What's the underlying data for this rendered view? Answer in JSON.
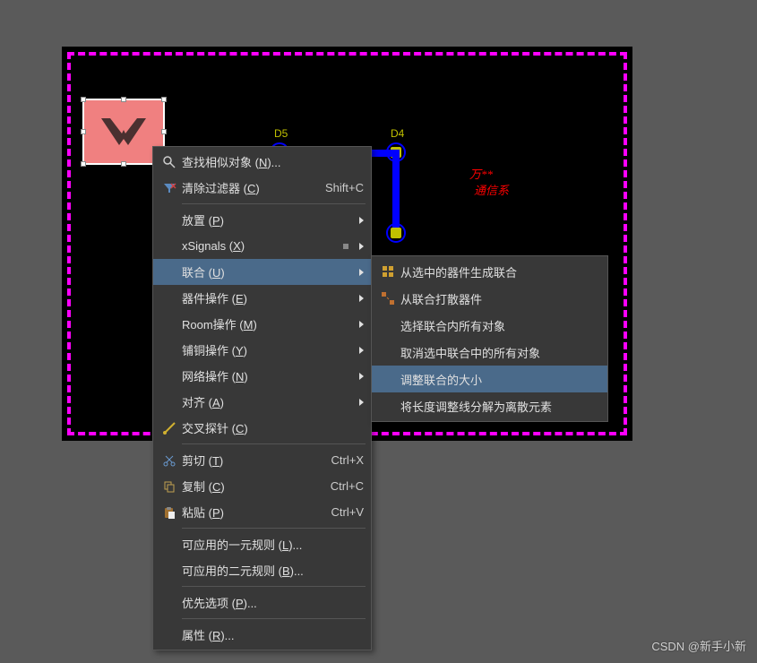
{
  "board": {
    "labels": {
      "d5": "D5",
      "d4": "D4"
    },
    "text1": "万**",
    "text2": "通信系"
  },
  "menu": {
    "items": [
      {
        "label": "查找相似对象 (N)...",
        "icon": "search-icon"
      },
      {
        "label": "清除过滤器 (C)",
        "shortcut": "Shift+C",
        "icon": "filter-clear-icon"
      },
      {
        "sep": true
      },
      {
        "label": "放置 (P)",
        "arrow": true
      },
      {
        "label": "xSignals (X)",
        "arrow": true,
        "dot": true
      },
      {
        "label": "联合 (U)",
        "arrow": true,
        "selected": true
      },
      {
        "label": "器件操作 (E)",
        "arrow": true
      },
      {
        "label": "Room操作 (M)",
        "arrow": true
      },
      {
        "label": "铺铜操作 (Y)",
        "arrow": true
      },
      {
        "label": "网络操作 (N)",
        "arrow": true
      },
      {
        "label": "对齐 (A)",
        "arrow": true
      },
      {
        "label": "交叉探针 (C)",
        "icon": "probe-icon"
      },
      {
        "sep": true
      },
      {
        "label": "剪切 (T)",
        "shortcut": "Ctrl+X",
        "icon": "cut-icon"
      },
      {
        "label": "复制 (C)",
        "shortcut": "Ctrl+C",
        "icon": "copy-icon"
      },
      {
        "label": "粘贴 (P)",
        "shortcut": "Ctrl+V",
        "icon": "paste-icon"
      },
      {
        "sep": true
      },
      {
        "label": "可应用的一元规则 (L)..."
      },
      {
        "label": "可应用的二元规则 (B)..."
      },
      {
        "sep": true
      },
      {
        "label": "优先选项 (P)..."
      },
      {
        "sep": true
      },
      {
        "label": "属性 (R)..."
      }
    ]
  },
  "submenu": {
    "items": [
      {
        "label": "从选中的器件生成联合",
        "icon": "union-create-icon"
      },
      {
        "label": "从联合打散器件",
        "icon": "union-break-icon"
      },
      {
        "label": "选择联合内所有对象"
      },
      {
        "label": "取消选中联合中的所有对象"
      },
      {
        "label": "调整联合的大小",
        "selected": true
      },
      {
        "label": "将长度调整线分解为离散元素"
      }
    ]
  },
  "watermark": "CSDN @新手小新"
}
